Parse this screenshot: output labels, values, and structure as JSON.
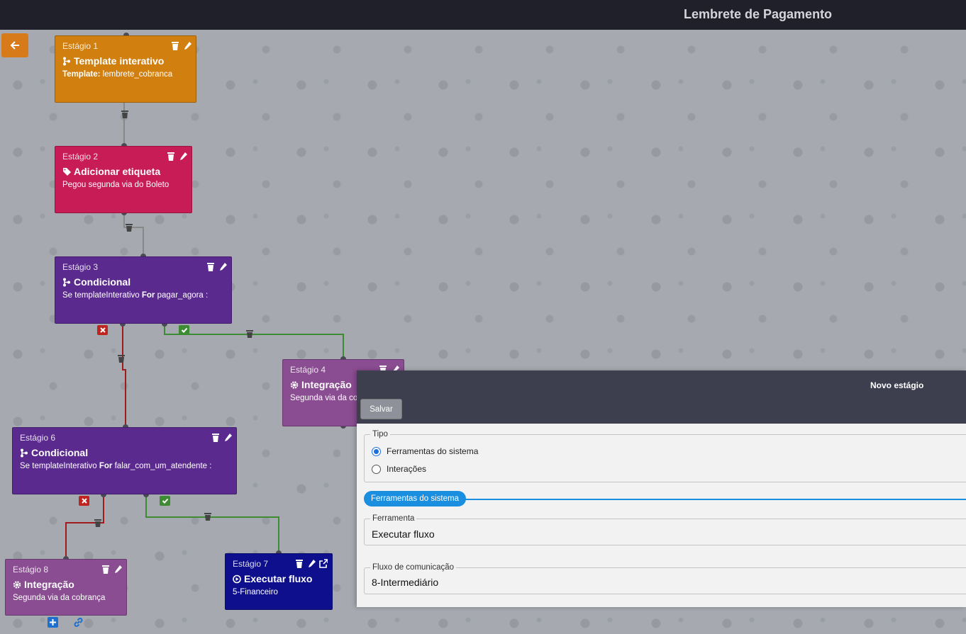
{
  "header": {
    "title": "Lembrete de Pagamento"
  },
  "colors": {
    "orange": "#d17f0f",
    "crimson": "#c71c55",
    "purple": "#5a2a8f",
    "mauve": "#8a4d91",
    "navy": "#0d0f8c",
    "edge_red": "#a01c1c",
    "edge_green": "#3d8c33",
    "accent_blue": "#1a8fe0"
  },
  "nodes": [
    {
      "stage": "Estágio 1",
      "type": "Template interativo",
      "desc_prefix": "Template:",
      "desc": "lembrete_cobranca",
      "icon": "branch-icon"
    },
    {
      "stage": "Estágio 2",
      "type": "Adicionar etiqueta",
      "desc_prefix": "",
      "desc": "Pegou segunda via do Boleto",
      "icon": "tag-icon"
    },
    {
      "stage": "Estágio 3",
      "type": "Condicional",
      "desc_prefix": "Se templateInterativo",
      "desc_for": "For",
      "desc": "pagar_agora :",
      "icon": "branch-icon"
    },
    {
      "stage": "Estágio 4",
      "type": "Integração",
      "desc_prefix": "",
      "desc": "Segunda via da cobrança",
      "icon": "gear-icon"
    },
    {
      "stage": "Estágio 6",
      "type": "Condicional",
      "desc_prefix": "Se templateInterativo",
      "desc_for": "For",
      "desc": "falar_com_um_atendente :",
      "icon": "branch-icon"
    },
    {
      "stage": "Estágio 8",
      "type": "Integração",
      "desc_prefix": "",
      "desc": "Segunda via da cobrança",
      "icon": "gear-icon"
    },
    {
      "stage": "Estágio 7",
      "type": "Executar fluxo",
      "desc_prefix": "",
      "desc": "5-Financeiro",
      "icon": "play-circle-icon"
    }
  ],
  "panel": {
    "title": "Novo estágio",
    "save_label": "Salvar",
    "tipo_legend": "Tipo",
    "options": [
      "Ferramentas do sistema",
      "Interações"
    ],
    "selected_option": "Ferramentas do sistema",
    "section_label": "Ferramentas do sistema",
    "tool_legend": "Ferramenta",
    "tool_value": "Executar fluxo",
    "flow_legend": "Fluxo de comunicação",
    "flow_value": "8-Intermediário"
  }
}
